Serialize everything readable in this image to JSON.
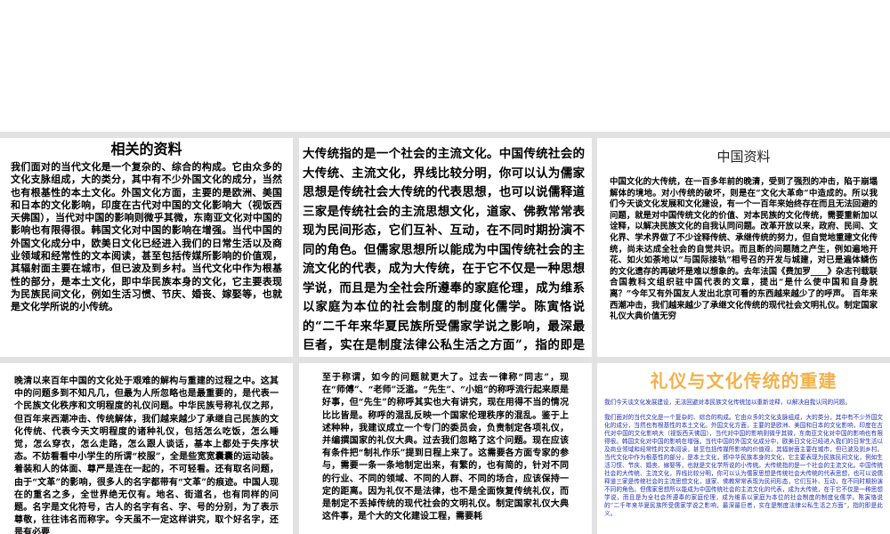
{
  "panels": {
    "p1": {
      "title": "相关的资料",
      "body": "我们面对的当代文化是一个复杂的、综合的构成。它由众多的文化支脉组成，大的类分，其中有不少外国文化的成分，当然也有根基性的本土文化。外国文化方面，主要的是欧洲、美国和日本的文化影响，印度在古代对中国的文化影响大（视饭西天佛国），当代对中国的影响则微乎其微，东南亚文化对中国的影响也有限得很。韩国文化对中国的影响在增强。当代中国的外国文化成分中，欧美日文化已经进入我们的日常生活以及商业领域和经常性的文本阅读，甚至包括传媒所影响的价值观，其辐射面主要在城市，但已波及到乡村。当代文化中作为根基性的部分，是本土文化，即中华民族本身的文化，它主要表现为民族民间文化，例如生活习惯、节庆、婚丧、嫁娶等，也就是文化学所说的小传统。"
    },
    "p2": {
      "body": "大传统指的是一个社会的主流文化。中国传统社会的大传统、主流文化，界线比较分明，你可以认为儒家思想是传统社会大传统的代表思想，也可以说儒释道三家是传统社会的主流思想文化，道家、佛教常常表现为民间形态，它们互补、互动，在不同时期扮演不同的角色。但儒家思想所以能成为中国传统社会的主流文化的代表，成为大传统，在于它不仅是一种思想学说，而且是为全社会所遵奉的家庭伦理，成为维系以家庭为本位的社会制度的制度化儒学。陈寅恪说的“二千年来华夏民族所受儒家学说之影响，最深最巨者，实在是制度法律公私生活之方面”，指的即是此义。"
    },
    "p3": {
      "title": "中国资料",
      "body": "中国文化的大传统，在一百多年前的晚清，受到了强烈的冲击，陷于崩塌解体的境地。对小传统的破坏，则是在“文化大革命”中造成的。所以我们今天谈文化发展和文化建设，有一个一百年来始终存在而且无法回避的问题，就是对中国传统文化的价值、对本民族的文化传统，需要重新加以诠释，以解决民族文化的自我认同问题。改革开放以来，政府、民间、文化界、学术界做了不少诠释传统、承继传统的努力，但自觉地重建文化传统，尚未达成全社会的自觉共识。而且断的问题随之产生，例如遍地开花、如火如荼地以“与国际接轨”相号召的开发与城建，对已是遍体鳞伤的文化遗存的再破坏是难以想象的。去年法国《费加罗____》杂志刊载联合国教科文组织驻中国代表的文章，提出“是什么使中国和自身脱离？”今年又有外国友人发出北京可看的东西越来越少了的呼声。  百年来西潮冲击，我们越来越少了承继文化传统的现代社会文明礼仪。制定国家礼仪大典价值无穷"
    },
    "p4": {
      "body": "晚清以来百年中国的文化处于艰难的解构与重建的过程之中。这其中的问题多到不知凡几，但最为人所忽略也是最重要的，是代表一个民族文化秩序和文明程度的礼仪问题。中华民族号称礼仪之邦，但百年来西潮冲击、传统解体，我们越来越少了承继自己民族的文化传统、代表今天文明程度的诸种礼仪，包括怎么吃饭，怎么睡觉，怎么穿衣，怎么走路，怎么跟人谈话，基本上都处于失序状态。不妨看看中小学生的所谓“校服”，全是些宽宽囊囊的运动装。着装和人的体面、尊严是连在一起的，不可轻看。还有取名问题，由于“文革”的影响，很多人的名字都带有“文革”的痕迹。中国人现在的重名之多，全世界绝无仅有。地名、街道名，也有同样的问题。名字是文化符号，古人的名字有名、字、号的分别，为了表示尊敬，往往讳名而称字。今天虽不一定这样讲究，取个好名字，还是有必要"
    },
    "p5": {
      "body": "至于称谓，如今的问题就更大了。过去一律称“同志”，现在“师傅”、“老师”泛滥。“先生”、“小姐”的称呼流行起来原是好事，但“先生”的称呼其实也大有讲究，现在用得不当的情况比比皆是。称呼的混乱反映一个国家伦理秩序的混乱。鉴于上述种种，我建议成立一个专门的委员会，负责制定各项礼仪，并编撰国家的礼仪大典。过去我们忽略了这个问题。现在应该有条件把“制礼作乐”提到日程上来了。这需要各方面专家的参与，需要一条一条地制定出来，有繁的，也有简的，针对不同的行业、不同的领域、不同的人群、不同的场合，应该保持一定的距离。因为礼仪不是法律，也不是全面恢复传统礼仪，而是制定不丢掉传统的现代社会的文明礼仪。制定国家礼仪大典这件事，是个大的文化建设工程，需要耗"
    },
    "p6": {
      "title": "礼仪与文化传统的重建",
      "lead": "我们今天谈文化发展建设，无法回避对本民族文化传统加以重新诠释，以解决自我认同的问题。",
      "body": "我们面对的当代文化是一个复杂的、综合的构成。它由众多的文化支脉组成，大的类分，其中有不少外国文化的成分，当然也有根基性的本土文化。外国文化方面，主要的是欧洲、美国和日本的文化影响，印度在古代对中国的文化影响大（视饭西天佛国），当代对中国的影响则微乎其微，东南亚文化对中国的影响也有限得很。韩国文化对中国的影响在增强。当代中国的外国文化成分中，欧美日文化已经进入我们的日常生活以及商业领域和经常性的文本阅读，甚至包括传媒所影响的价值观，其辐射面主要在城市，但已波及到乡村。当代文化中作为根基性的部分，是本土文化，即中华民族本身的文化，它主要表现为民族民间文化，例如生活习惯、节庆、婚丧、嫁娶等，也就是文化学所说的小传统。大传统指的是一个社会的主流文化。中国传统社会的大传统、主流文化，界线比较分明，你可以认为儒家思想是传统社会大传统的代表思想，也可以说儒释道三家是传统社会的主流思想文化，道家、佛教常常表现为民间形态，它们互补、互动，在不同时期扮演不同的角色。但儒家思想所以能成为中国传统社会的主流文化的代表，成为大传统，在于它不仅是一种思想学说，而且是为全社会所遵奉的家庭伦理，成为维系以家庭为本位的社会制度的制度化儒学。陈寅恪说的“二千年来华夏民族所受儒家学说之影响，最深最巨者，实在是制度法律公私生活之方面”，指的即是此义。"
    }
  }
}
